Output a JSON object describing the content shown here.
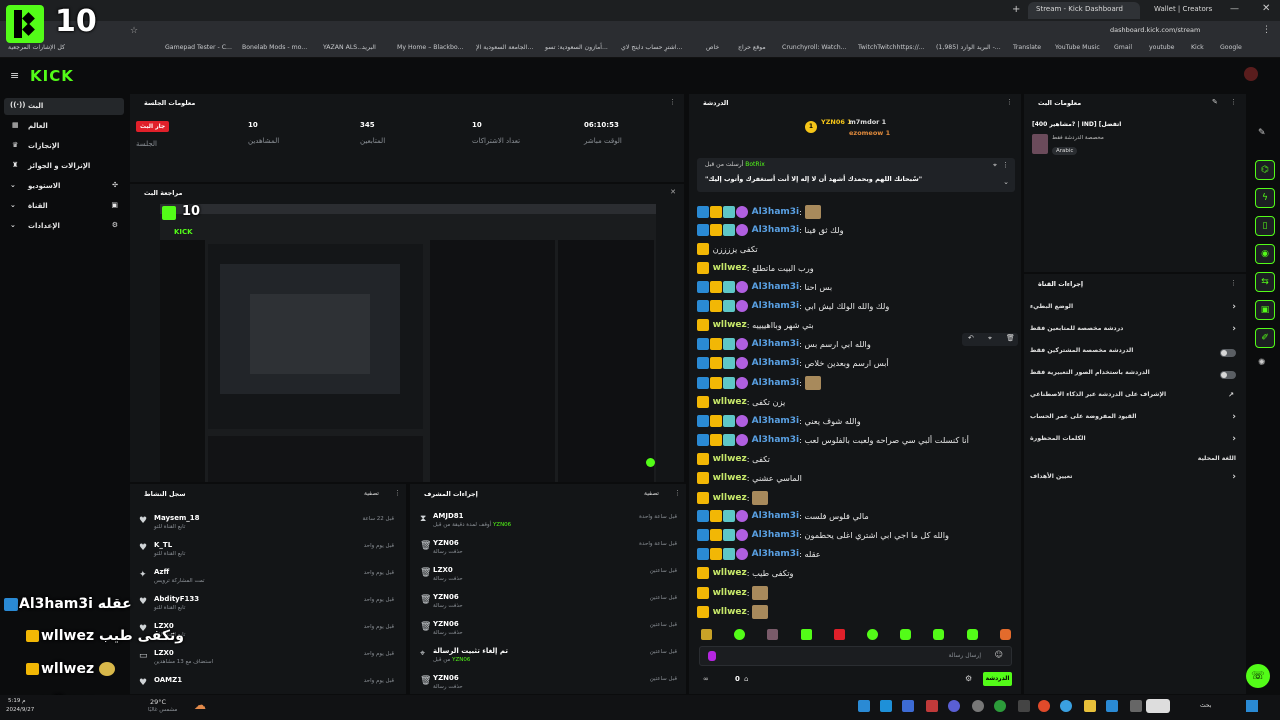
{
  "browser": {
    "tabs": [
      {
        "label": "Stream - Kick Dashboard",
        "active": true
      },
      {
        "label": "Wallet | Creators",
        "active": false
      }
    ],
    "url": "dashboard.kick.com/stream",
    "bookmarks_label": "كل الإشارات المرجعية",
    "bookmarks": [
      "Gamepad Tester - C...",
      "Bonelab Mods - mo...",
      "YAZAN ALS...",
      "البريد",
      "My Home – Blackbo...",
      "الجامعة السعودية الإ...",
      "أمازون السعودية: تسو...",
      "اشترِ حساب دايتج لاي...",
      "خاص",
      "موقع حراج",
      "Crunchyroll: Watch...",
      "TwitchTwitchhttps://...",
      "(1,985) البريد الوارد -...",
      "Translate",
      "YouTube Music",
      "Gmail",
      "youtube",
      "Kick",
      "Google"
    ]
  },
  "overlay_top": {
    "count": "10"
  },
  "kick": {
    "logo": "KICK",
    "colors": {
      "accent": "#53fc18",
      "badge_red": "#e0202a",
      "bg": "#0b0c0d",
      "panel": "#131517"
    }
  },
  "sidebar": {
    "items": [
      "البث",
      "العالم",
      "الإنجازات",
      "الإنزالات و الجوائز",
      "الاستوديو",
      "القناة",
      "الإعدادات"
    ]
  },
  "session": {
    "title": "معلومات الجلسة",
    "live_badge": "جار البث",
    "session_label": "الجلسة",
    "stats": [
      {
        "value": "10",
        "label": "المشاهدين"
      },
      {
        "value": "345",
        "label": "المتابعين"
      },
      {
        "value": "10",
        "label": "تعداد الاشتراكات"
      },
      {
        "value": "06:10:53",
        "label": "الوقت مباشر"
      }
    ]
  },
  "preview": {
    "title": "مراجعة البث",
    "mini_count": "10",
    "mini_logo": "KICK"
  },
  "activity": {
    "title": "سجل النشاط",
    "filter": "تصفية",
    "items": [
      {
        "name": "Maysem_18",
        "sub": "تابع القناة للتو",
        "time": "قبل 22 ساعة"
      },
      {
        "name": "K_TL",
        "sub": "تابع القناة للتو",
        "time": "قبل يوم واحد"
      },
      {
        "name": "Azff",
        "sub": "تمت المشاركة ترويس",
        "time": "قبل يوم واحد"
      },
      {
        "name": "AbdityF133",
        "sub": "تابع القناة للتو",
        "time": "قبل يوم واحد"
      },
      {
        "name": "LZX0",
        "sub": "تابع القناة للتو",
        "time": "قبل يوم واحد"
      },
      {
        "name": "LZX0",
        "sub": "استضاف مع 13 مشاهدين",
        "time": "قبل يوم واحد"
      },
      {
        "name": "OAMZ1",
        "sub": "",
        "time": "قبل يوم واحد"
      }
    ]
  },
  "mod": {
    "title": "إجراءات المشرف",
    "filter": "تصفية",
    "items": [
      {
        "name": "AMJD81",
        "sub": "أوقف لمدة دقيقة من قبل",
        "by": "YZN06",
        "time": "قبل ساعة واحدة"
      },
      {
        "name": "YZN06",
        "sub": "حذفت رسالة",
        "by": "",
        "time": "قبل ساعة واحدة"
      },
      {
        "name": "LZX0",
        "sub": "حذفت رسالة",
        "by": "",
        "time": "قبل ساعتين"
      },
      {
        "name": "YZN06",
        "sub": "حذفت رسالة",
        "by": "",
        "time": "قبل ساعتين"
      },
      {
        "name": "YZN06",
        "sub": "حذفت رسالة",
        "by": "",
        "time": "قبل ساعتين"
      },
      {
        "name": "تم إلغاء تثبيت الرسالة",
        "sub": "من قبل",
        "by": "YZN06",
        "time": "قبل ساعتين"
      },
      {
        "name": "YZN06",
        "sub": "حذفت رسالة",
        "by": "",
        "time": "قبل ساعتين"
      }
    ]
  },
  "chat": {
    "title": "الدردشة",
    "top_gifters": [
      {
        "name": "YZN06",
        "count": "1"
      },
      {
        "name": "m7mdor",
        "count": "1"
      },
      {
        "name": "ezomeow",
        "count": "1"
      }
    ],
    "pinned": {
      "label": "أرسلت من قبل",
      "author": "BotRix",
      "text": "\"سُبحانك اللهم وبحمدك أشهد أن لا إله إلا أنت أستغفرك وأتوب إليك\""
    },
    "messages": [
      {
        "user": "Al3ham3i",
        "type": "blue",
        "text": "",
        "emote": true
      },
      {
        "user": "Al3ham3i",
        "type": "blue",
        "text": "ولك ثق فينا",
        "emote": false
      },
      {
        "user": "",
        "type": "yellow",
        "text": "تكفى يززززن",
        "emote": false
      },
      {
        "user": "wllwez",
        "type": "yellow",
        "text": "ورب البيت ماتطلع",
        "emote": false
      },
      {
        "user": "Al3ham3i",
        "type": "blue",
        "text": "بس احنا",
        "emote": false
      },
      {
        "user": "Al3ham3i",
        "type": "blue",
        "text": "ولك والله الولك ليش ابي",
        "emote": false
      },
      {
        "user": "wllwez",
        "type": "yellow",
        "text": "بتي شهر وبااهييييه",
        "emote": false
      },
      {
        "user": "Al3ham3i",
        "type": "blue",
        "text": "والله ابي ارسم بس",
        "emote": false
      },
      {
        "user": "Al3ham3i",
        "type": "blue",
        "text": "أبس ارسم وبعدين خلاص",
        "emote": false
      },
      {
        "user": "Al3ham3i",
        "type": "blue",
        "text": "",
        "emote": true
      },
      {
        "user": "wllwez",
        "type": "yellow",
        "text": "يزن تكفى",
        "emote": false
      },
      {
        "user": "Al3ham3i",
        "type": "blue",
        "text": "والله شوف يعني",
        "emote": false
      },
      {
        "user": "Al3ham3i",
        "type": "blue",
        "text": "أنا كنسلت ألبي سي صراحه ولعبت بالفلوس لعب",
        "emote": false
      },
      {
        "user": "wllwez",
        "type": "yellow",
        "text": "تكفى",
        "emote": false
      },
      {
        "user": "wllwez",
        "type": "yellow",
        "text": "الماسي عشني",
        "emote": false
      },
      {
        "user": "wllwez",
        "type": "yellow",
        "text": "",
        "emote": true
      },
      {
        "user": "Al3ham3i",
        "type": "blue",
        "text": "مالي فلوس فلست",
        "emote": false
      },
      {
        "user": "Al3ham3i",
        "type": "blue",
        "text": "والله كل ما اجي ابي اشتري اغلى يحطمون",
        "emote": false
      },
      {
        "user": "Al3ham3i",
        "type": "blue",
        "text": "عقله",
        "emote": false
      },
      {
        "user": "wllwez",
        "type": "yellow",
        "text": "وتكفى طيب",
        "emote": false
      },
      {
        "user": "wllwez",
        "type": "yellow",
        "text": "",
        "emote": true
      },
      {
        "user": "wllwez",
        "type": "yellow",
        "text": "",
        "emote": true
      }
    ],
    "input_placeholder": "إرسال رسالة",
    "points": "0",
    "send_label": "الدردشة"
  },
  "stream_info": {
    "title": "معلومات البث",
    "stream_title": "[مشاهير 400? | IND] [اتفضل",
    "category": "مخصصة الدردشة فقط",
    "language": "Arabic"
  },
  "controls": {
    "title": "إجراءات القناة",
    "items": [
      {
        "label": "الوضع البطيء",
        "kind": "arrow"
      },
      {
        "label": "دردشة مخصصة للمتابعين فقط",
        "kind": "arrow"
      },
      {
        "label": "الدردشة مخصصة المشتركين فقط",
        "kind": "toggle"
      },
      {
        "label": "الدردشة باستخدام الصور التعبيرية فقط",
        "kind": "toggle"
      },
      {
        "label": "الإشراف على الدردشة عبر الذكاء الاصطناعي",
        "kind": "link"
      },
      {
        "label": "القيود المفروضة على عمر الحساب",
        "kind": "arrow"
      },
      {
        "label": "الكلمات المحظورة",
        "kind": "arrow"
      },
      {
        "label": "اللغة المحلية",
        "kind": "none"
      },
      {
        "label": "تعيين الأهداف",
        "kind": "arrow"
      }
    ]
  },
  "overlay_chat": [
    {
      "user": "Al3ham3i",
      "text": "عقله"
    },
    {
      "user": "wllwez",
      "text": "وتكفى طيب"
    },
    {
      "user": "wllwez",
      "text": ""
    },
    {
      "user": "wllwez",
      "text": ""
    }
  ],
  "taskbar": {
    "weather": "29°C",
    "weather_sub": "مشمس غالبًا",
    "time": "م 5:19",
    "date": "2024/9/27",
    "search": "بحث"
  }
}
